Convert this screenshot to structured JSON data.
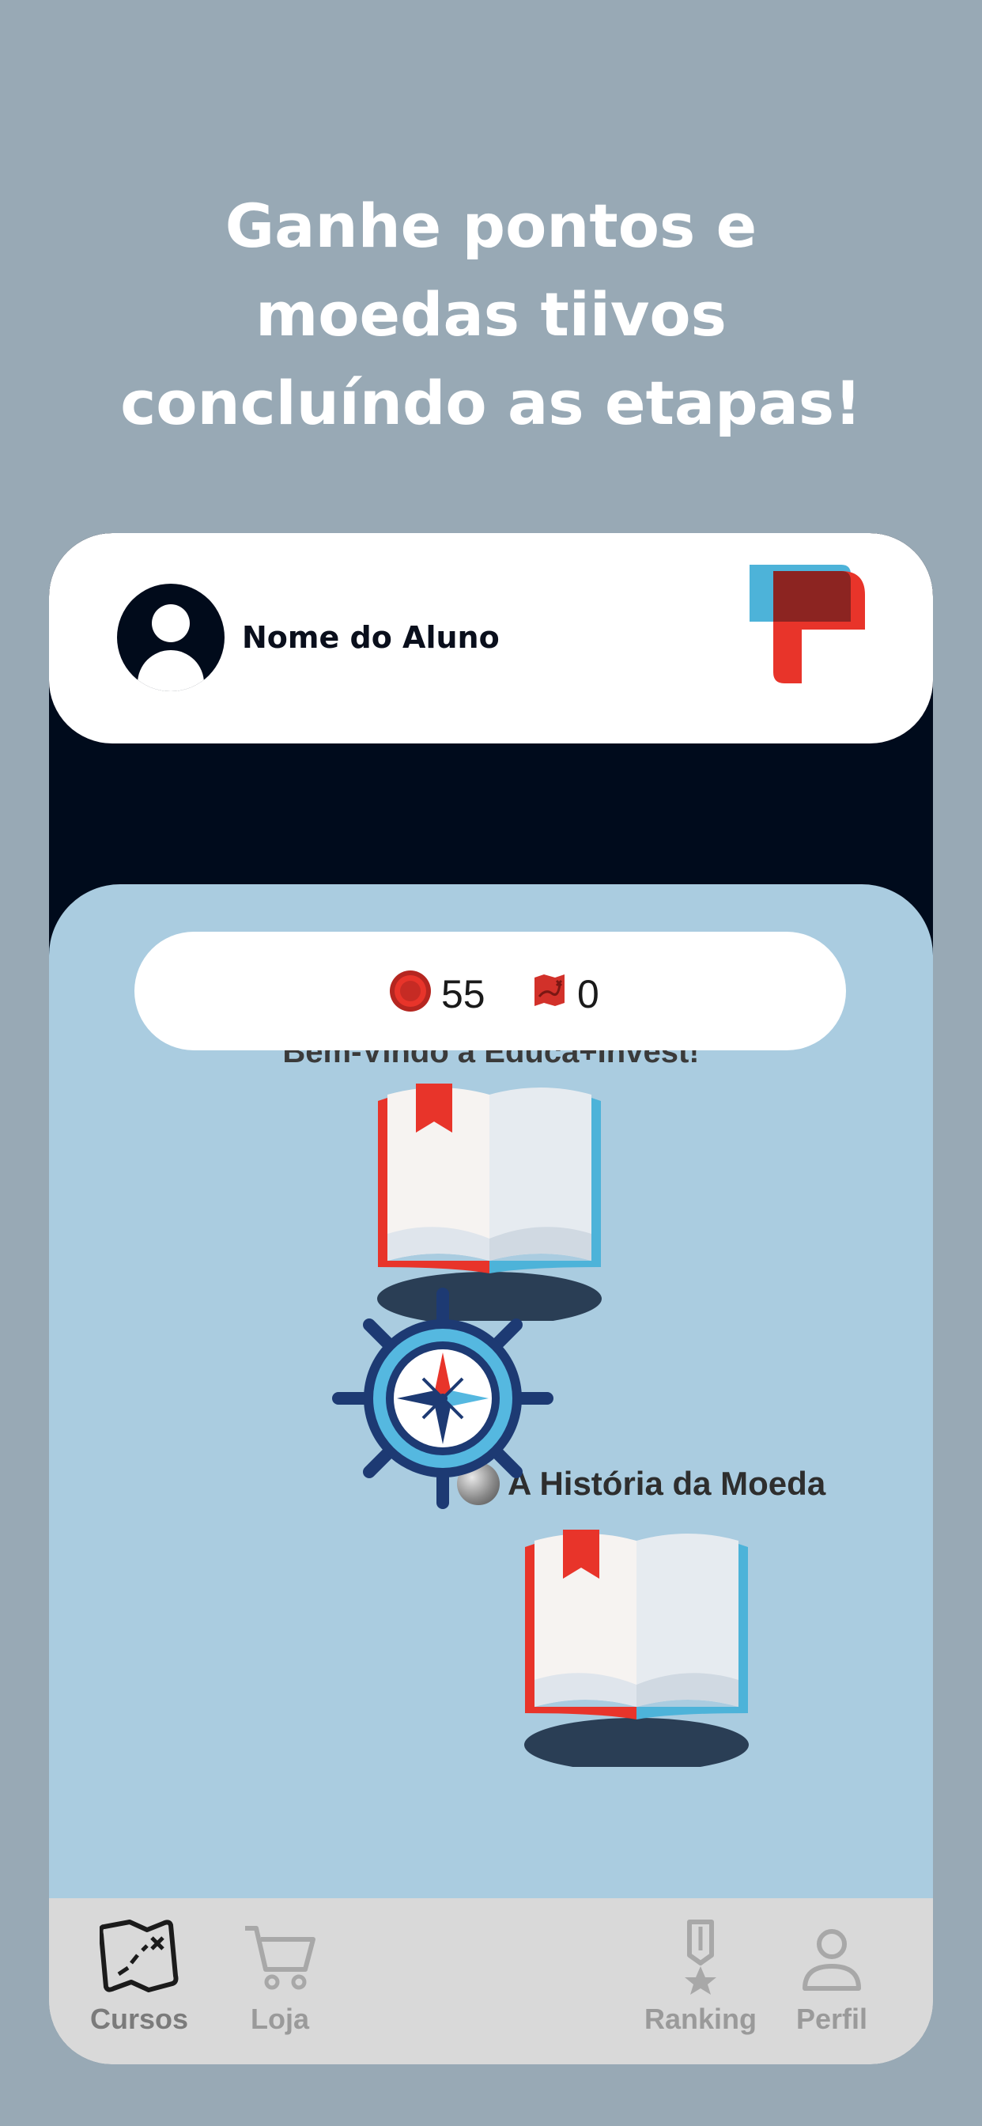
{
  "promo": {
    "line1": "Ganhe pontos e",
    "line2": "moedas tiivos",
    "line3": "concluíndo as etapas!"
  },
  "header": {
    "student_name": "Nome do Aluno",
    "avatar_icon": "user-avatar-icon",
    "logo_icon": "app-logo-icon"
  },
  "stats": {
    "coins": "55",
    "coin_icon": "coin-icon",
    "maps": "0",
    "map_icon": "treasure-map-icon"
  },
  "lessons": [
    {
      "title": "Bem-Vindo à Educa+Invest!",
      "icon": "open-book-icon"
    },
    {
      "title": "A História da Moeda",
      "icon": "open-book-icon",
      "badge_icon": "globe-icon"
    }
  ],
  "nav": {
    "cursos": "Cursos",
    "loja": "Loja",
    "ranking": "Ranking",
    "perfil": "Perfil",
    "center_icon": "ship-wheel-compass-icon"
  },
  "colors": {
    "background": "#98a9b5",
    "dark": "#000b1c",
    "content": "#aacce0",
    "accent_red": "#e8342a",
    "accent_blue": "#4db3d9",
    "nav_bg": "#d9d9d9"
  }
}
